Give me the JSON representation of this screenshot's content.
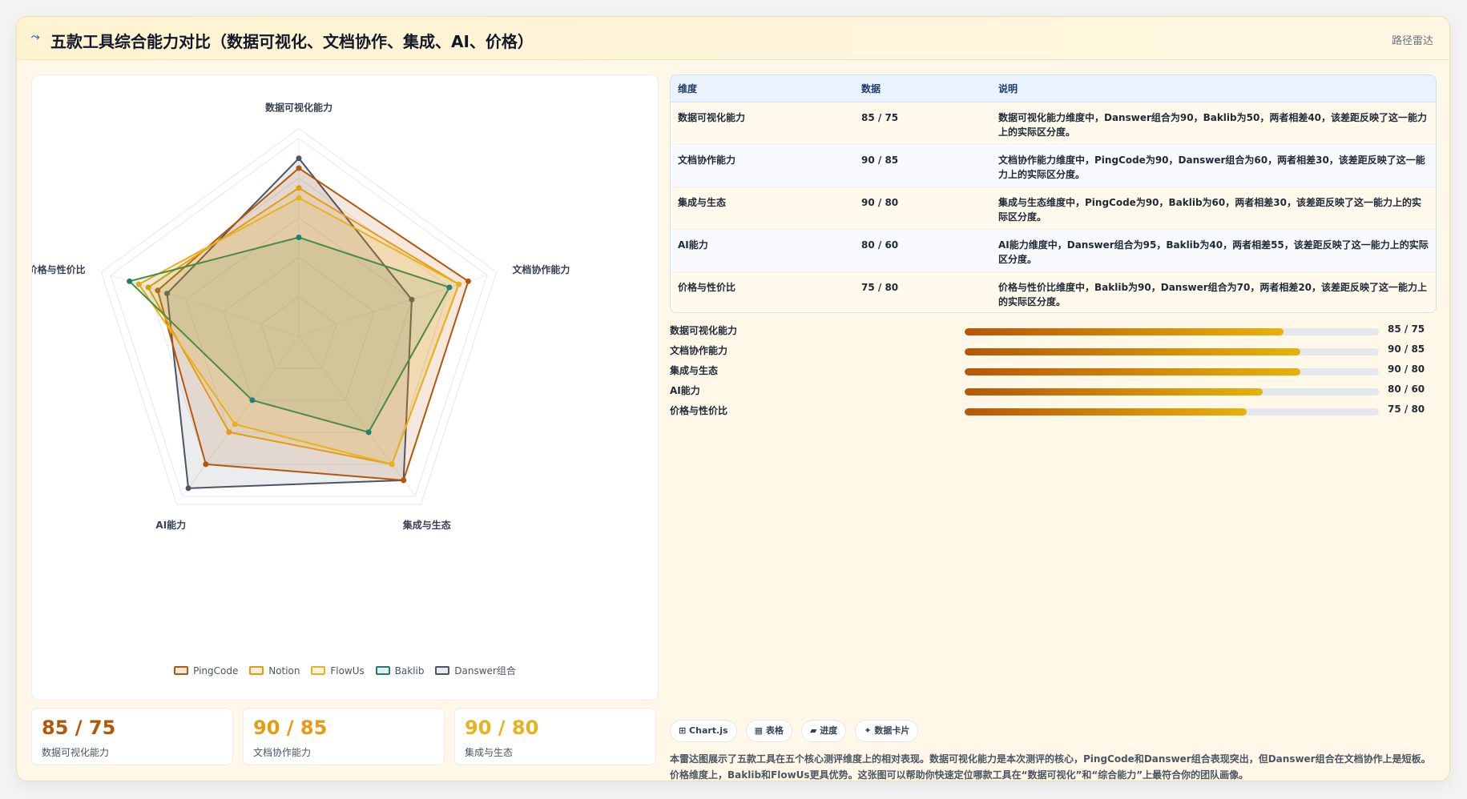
{
  "header": {
    "icon": "⤳",
    "title": "五款工具综合能力对比（数据可视化、文档协作、集成、AI、价格）",
    "tag": "路径雷达"
  },
  "colors": {
    "PingCode": "#b5570a",
    "Notion": "#e69b12",
    "FlowUs": "#e8b21e",
    "Baklib": "#1b7f74",
    "Danswer组合": "#4b5563",
    "Baklib_line": "#4a8b3c"
  },
  "chart_data": {
    "type": "radar",
    "axes": [
      "数据可视化能力",
      "文档协作能力",
      "集成与生态",
      "AI能力",
      "价格与性价比"
    ],
    "range": [
      0,
      100
    ],
    "series": [
      {
        "name": "PingCode",
        "values": [
          85,
          90,
          90,
          80,
          75
        ]
      },
      {
        "name": "Notion",
        "values": [
          75,
          85,
          80,
          60,
          80
        ]
      },
      {
        "name": "FlowUs",
        "values": [
          70,
          85,
          80,
          55,
          85
        ]
      },
      {
        "name": "Baklib",
        "values": [
          50,
          80,
          60,
          40,
          90
        ]
      },
      {
        "name": "Danswer组合",
        "values": [
          90,
          60,
          90,
          95,
          70
        ]
      }
    ]
  },
  "kpis": [
    {
      "value": "85 / 75",
      "label": "数据可视化能力",
      "color": "#b5570a"
    },
    {
      "value": "90 / 85",
      "label": "文档协作能力",
      "color": "#e69b12"
    },
    {
      "value": "90 / 80",
      "label": "集成与生态",
      "color": "#e8b21e"
    }
  ],
  "table": {
    "headers": [
      "维度",
      "数据",
      "说明"
    ],
    "rows": [
      [
        "数据可视化能力",
        "85 / 75",
        "数据可视化能力维度中，Danswer组合为90，Baklib为50，两者相差40，该差距反映了这一能力上的实际区分度。"
      ],
      [
        "文档协作能力",
        "90 / 85",
        "文档协作能力维度中，PingCode为90，Danswer组合为60，两者相差30，该差距反映了这一能力上的实际区分度。"
      ],
      [
        "集成与生态",
        "90 / 80",
        "集成与生态维度中，PingCode为90，Baklib为60，两者相差30，该差距反映了这一能力上的实际区分度。"
      ],
      [
        "AI能力",
        "80 / 60",
        "AI能力维度中，Danswer组合为95，Baklib为40，两者相差55，该差距反映了这一能力上的实际区分度。"
      ],
      [
        "价格与性价比",
        "75 / 80",
        "价格与性价比维度中，Baklib为90，Danswer组合为70，两者相差20，该差距反映了这一能力上的实际区分度。"
      ]
    ]
  },
  "bars": [
    {
      "label": "数据可视化能力",
      "value": "85 / 75",
      "pct": 0.77
    },
    {
      "label": "文档协作能力",
      "value": "90 / 85",
      "pct": 0.81
    },
    {
      "label": "集成与生态",
      "value": "90 / 80",
      "pct": 0.81
    },
    {
      "label": "AI能力",
      "value": "80 / 60",
      "pct": 0.72
    },
    {
      "label": "价格与性价比",
      "value": "75 / 80",
      "pct": 0.68
    }
  ],
  "chips": [
    "⊞ Chart.js",
    "▦ 表格",
    "▰ 进度",
    "✦ 数据卡片"
  ],
  "summary": "本雷达图展示了五款工具在五个核心测评维度上的相对表现。数据可视化能力是本次测评的核心，PingCode和Danswer组合表现突出，但Danswer组合在文档协作上是短板。价格维度上，Baklib和FlowUs更具优势。这张图可以帮助你快速定位哪款工具在“数据可视化”和“综合能力”上最符合你的团队画像。"
}
